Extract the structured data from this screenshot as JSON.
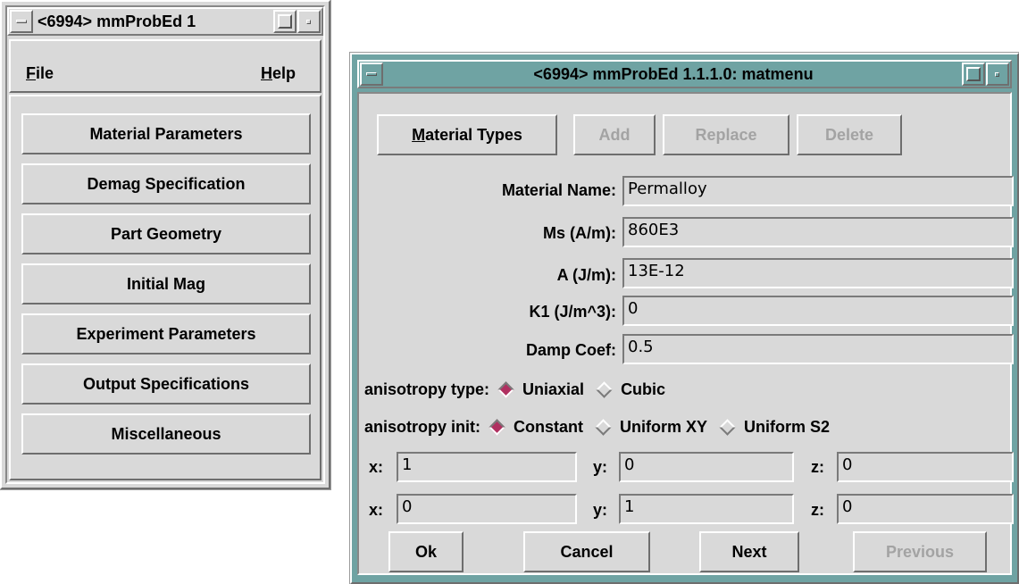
{
  "main_window": {
    "title": "<6994> mmProbEd 1",
    "menu": {
      "file": {
        "mnemonic": "F",
        "rest": "ile"
      },
      "help": {
        "mnemonic": "H",
        "rest": "elp"
      }
    },
    "buttons": [
      "Material Parameters",
      "Demag Specification",
      "Part Geometry",
      "Initial Mag",
      "Experiment Parameters",
      "Output Specifications",
      "Miscellaneous"
    ]
  },
  "dialog": {
    "title": "<6994> mmProbEd 1.1.1.0: matmenu",
    "toolbar": {
      "material_types": {
        "mnemonic": "M",
        "rest": "aterial Types"
      },
      "add": "Add",
      "replace": "Replace",
      "delete": "Delete"
    },
    "fields": [
      {
        "label": "Material Name:",
        "value": "Permalloy"
      },
      {
        "label": "Ms (A/m):",
        "value": "860E3"
      },
      {
        "label": "A (J/m):",
        "value": "13E-12"
      },
      {
        "label": "K1 (J/m^3):",
        "value": "0"
      },
      {
        "label": "Damp Coef:",
        "value": "0.5"
      }
    ],
    "anisotropy_type": {
      "label": "anisotropy type:",
      "options": [
        "Uniaxial",
        "Cubic"
      ],
      "selected": "Uniaxial"
    },
    "anisotropy_init": {
      "label": "anisotropy init:",
      "options": [
        "Constant",
        "Uniform XY",
        "Uniform S2"
      ],
      "selected": "Constant"
    },
    "vectors": [
      {
        "x_label": "x:",
        "x": "1",
        "y_label": "y:",
        "y": "0",
        "z_label": "z:",
        "z": "0"
      },
      {
        "x_label": "x:",
        "x": "0",
        "y_label": "y:",
        "y": "1",
        "z_label": "z:",
        "z": "0"
      }
    ],
    "bottom_buttons": {
      "ok": "Ok",
      "cancel": "Cancel",
      "next": "Next",
      "previous": "Previous"
    }
  },
  "colors": {
    "active_title": "#6fa3a3",
    "background": "#d9d9d9",
    "radio_selected": "#b03060",
    "disabled_text": "#a3a3a3"
  }
}
